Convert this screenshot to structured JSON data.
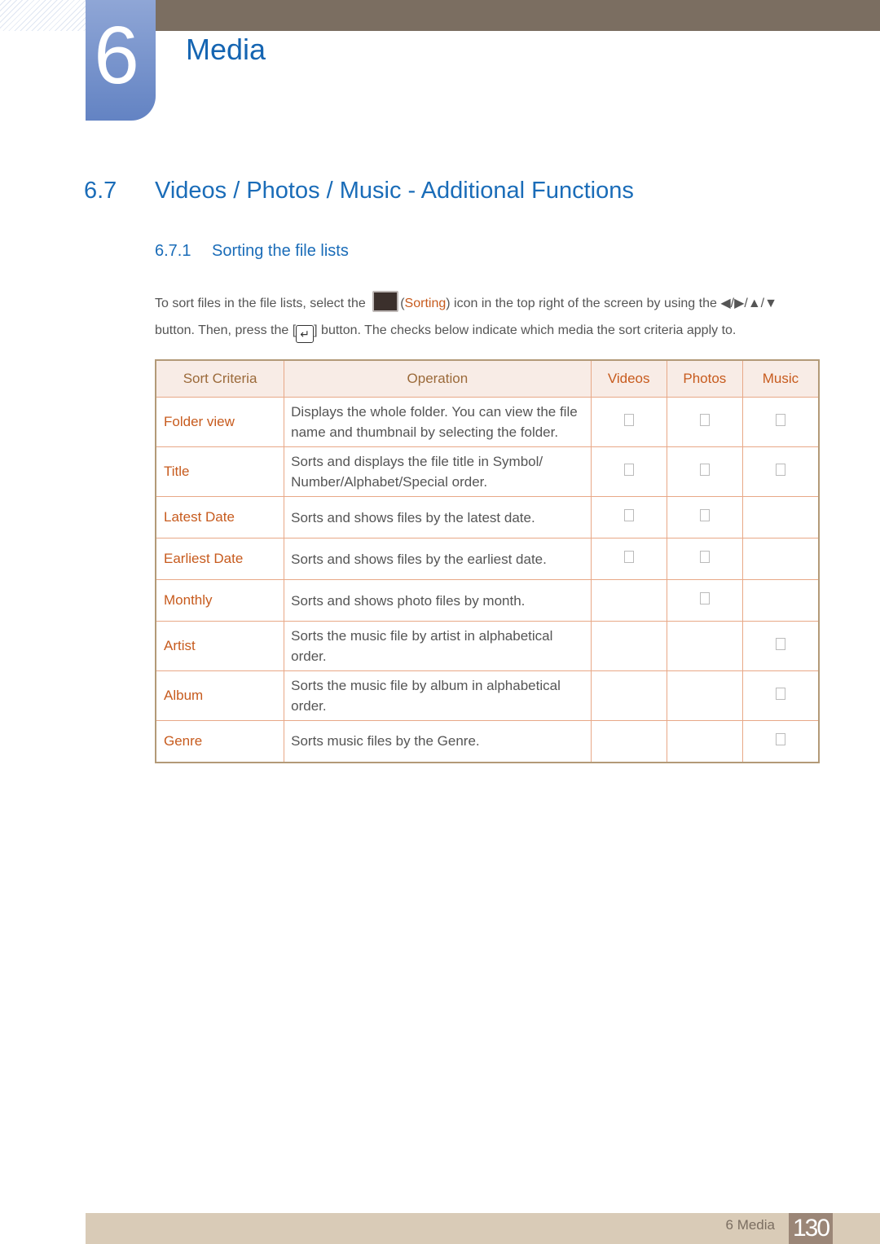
{
  "chapter": {
    "number": "6",
    "title": "Media"
  },
  "section": {
    "number": "6.7",
    "title": "Videos / Photos / Music - Additional Functions"
  },
  "subsection": {
    "number": "6.7.1",
    "title": "Sorting the file lists"
  },
  "intro": {
    "part1": "To sort files in the file lists, select the ",
    "sorting_label": "Sorting",
    "part2": " icon in the top right of the screen by using the ",
    "arrows": "◀/▶/▲/▼",
    "part3": "button. Then, press the [",
    "part4": "] button. The checks below indicate which media the sort criteria apply to.",
    "icon_sorting": "sorting-icon",
    "icon_enter": "enter-icon"
  },
  "table": {
    "headers": [
      "Sort Criteria",
      "Operation",
      "Videos",
      "Photos",
      "Music"
    ],
    "rows": [
      {
        "criteria": "Folder view",
        "operation": "Displays the whole folder. You can view the file name and thumbnail by selecting the folder.",
        "videos": true,
        "photos": true,
        "music": true
      },
      {
        "criteria": "Title",
        "operation": "Sorts and displays the file title in Symbol/ Number/Alphabet/Special order.",
        "videos": true,
        "photos": true,
        "music": true
      },
      {
        "criteria": "Latest Date",
        "operation": "Sorts and shows files by the latest date.",
        "videos": true,
        "photos": true,
        "music": false
      },
      {
        "criteria": "Earliest Date",
        "operation": "Sorts and shows files by the earliest date.",
        "videos": true,
        "photos": true,
        "music": false
      },
      {
        "criteria": "Monthly",
        "operation": "Sorts and shows photo files by month.",
        "videos": false,
        "photos": true,
        "music": false
      },
      {
        "criteria": "Artist",
        "operation": "Sorts the music file by artist in alphabetical order.",
        "videos": false,
        "photos": false,
        "music": true
      },
      {
        "criteria": "Album",
        "operation": "Sorts the music file by album in alphabetical order.",
        "videos": false,
        "photos": false,
        "music": true
      },
      {
        "criteria": "Genre",
        "operation": "Sorts music files by the Genre.",
        "videos": false,
        "photos": false,
        "music": true
      }
    ]
  },
  "footer": {
    "label": "6 Media",
    "page": "130"
  }
}
